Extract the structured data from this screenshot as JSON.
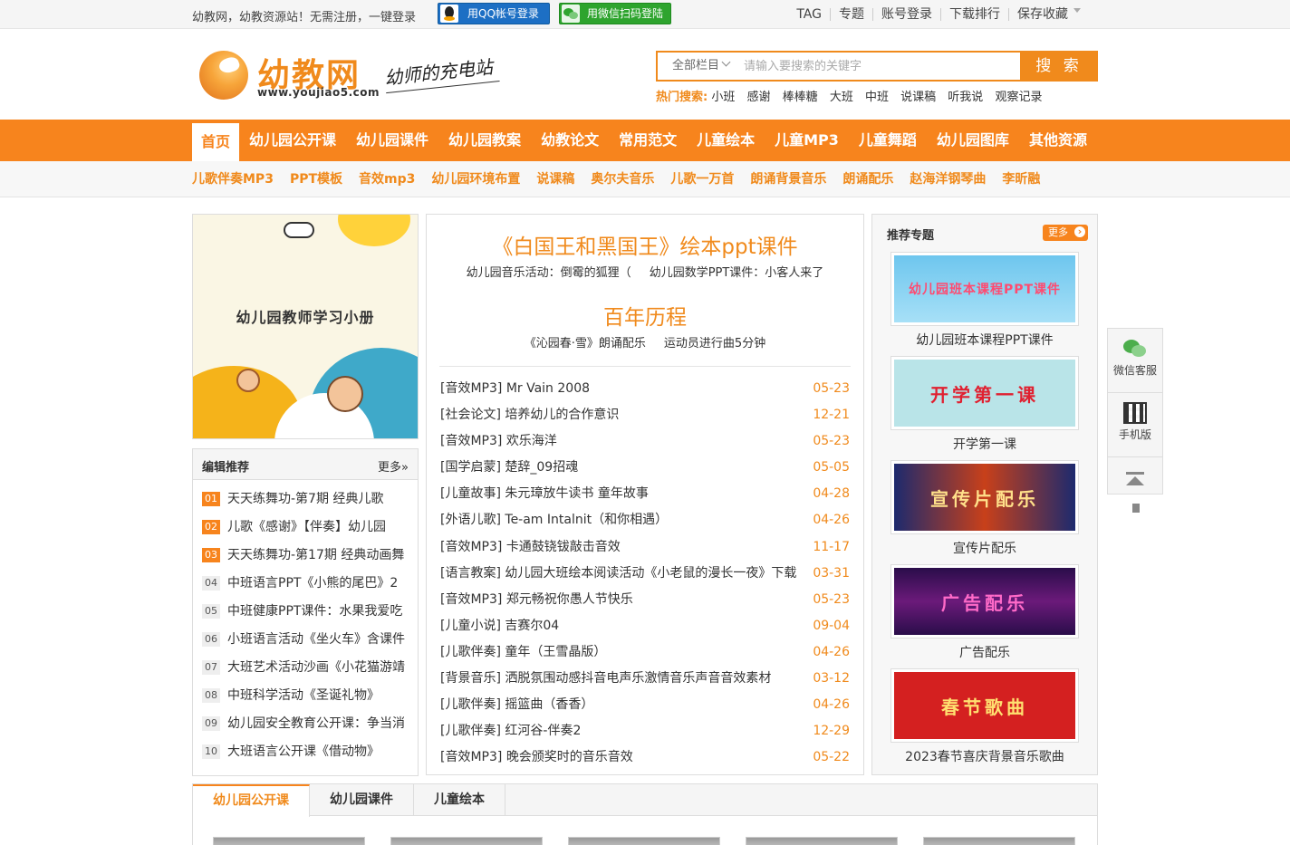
{
  "topbar": {
    "welcome": "幼教网，幼教资源站！无需注册，一键登录",
    "qq_login": "用QQ帐号登录",
    "wx_login": "用微信扫码登陆",
    "links": [
      "TAG",
      "专题",
      "账号登录",
      "下载排行",
      "保存收藏"
    ]
  },
  "header": {
    "logo_name": "幼教网",
    "logo_url": "www.youjiao5.com",
    "slogan": "幼师的充电站",
    "search_category": "全部栏目",
    "search_placeholder": "请输入要搜索的关键字",
    "search_button": "搜 索",
    "hot_label": "热门搜索:",
    "hot_words": [
      "小班",
      "感谢",
      "棒棒糖",
      "大班",
      "中班",
      "说课稿",
      "听我说",
      "观察记录"
    ]
  },
  "nav": [
    "首页",
    "幼儿园公开课",
    "幼儿园课件",
    "幼儿园教案",
    "幼教论文",
    "常用范文",
    "儿童绘本",
    "儿童MP3",
    "儿童舞蹈",
    "幼儿园图库",
    "其他资源"
  ],
  "subnav": [
    "儿歌伴奏MP3",
    "PPT模板",
    "音效mp3",
    "幼儿园环境布置",
    "说课稿",
    "奥尔夫音乐",
    "儿歌一万首",
    "朗诵背景音乐",
    "朗诵配乐",
    "赵海洋钢琴曲",
    "李昕融"
  ],
  "banner": {
    "title": "幼儿园教师学习小册"
  },
  "editor": {
    "title": "编辑推荐",
    "more": "更多»",
    "items": [
      {
        "n": "01",
        "t": "天天练舞功-第7期 经典儿歌"
      },
      {
        "n": "02",
        "t": "儿歌《感谢》【伴奏】幼儿园"
      },
      {
        "n": "03",
        "t": "天天练舞功-第17期 经典动画舞"
      },
      {
        "n": "04",
        "t": "中班语言PPT《小熊的尾巴》2"
      },
      {
        "n": "05",
        "t": "中班健康PPT课件：水果我爱吃"
      },
      {
        "n": "06",
        "t": "小班语言活动《坐火车》含课件"
      },
      {
        "n": "07",
        "t": "大班艺术活动沙画《小花猫游靖"
      },
      {
        "n": "08",
        "t": "中班科学活动《圣诞礼物》"
      },
      {
        "n": "09",
        "t": "幼儿园安全教育公开课：争当消"
      },
      {
        "n": "10",
        "t": "大班语言公开课《借动物》"
      }
    ]
  },
  "headline": {
    "h1": "《白国王和黑国王》绘本ppt课件",
    "sub1": [
      "幼儿园音乐活动：倒霉的狐狸（",
      "幼儿园数学PPT课件：小客人来了"
    ],
    "h2": "百年历程",
    "sub2": [
      "《沁园春·雪》朗诵配乐",
      "运动员进行曲5分钟"
    ]
  },
  "news": [
    {
      "tag": "[音效MP3]",
      "t": "Mr Vain 2008",
      "d": "05-23"
    },
    {
      "tag": "[社会论文]",
      "t": "培养幼儿的合作意识",
      "d": "12-21"
    },
    {
      "tag": "[音效MP3]",
      "t": "欢乐海洋",
      "d": "05-23"
    },
    {
      "tag": "[国学启蒙]",
      "t": "楚辞_09招魂",
      "d": "05-05"
    },
    {
      "tag": "[儿童故事]",
      "t": "朱元璋放牛读书 童年故事",
      "d": "04-28"
    },
    {
      "tag": "[外语儿歌]",
      "t": "Te-am Intalnit（和你相遇）",
      "d": "04-26"
    },
    {
      "tag": "[音效MP3]",
      "t": "卡通鼓铙钹敲击音效",
      "d": "11-17"
    },
    {
      "tag": "[语言教案]",
      "t": "幼儿园大班绘本阅读活动《小老鼠的漫长一夜》下载",
      "d": "03-31"
    },
    {
      "tag": "[音效MP3]",
      "t": "郑元畅祝你愚人节快乐",
      "d": "05-23"
    },
    {
      "tag": "[儿童小说]",
      "t": "吉赛尔04",
      "d": "09-04"
    },
    {
      "tag": "[儿歌伴奏]",
      "t": "童年（王雪晶版）",
      "d": "04-26"
    },
    {
      "tag": "[背景音乐]",
      "t": "洒脱氛围动感抖音电声乐激情音乐声音音效素材",
      "d": "03-12"
    },
    {
      "tag": "[儿歌伴奏]",
      "t": "摇篮曲（香香）",
      "d": "04-26"
    },
    {
      "tag": "[儿歌伴奏]",
      "t": "红河谷-伴奏2",
      "d": "12-29"
    },
    {
      "tag": "[音效MP3]",
      "t": "晚会颁奖时的音乐音效",
      "d": "05-22"
    }
  ],
  "topics": {
    "title": "推荐专题",
    "more": "更多",
    "items": [
      {
        "img_text": "幼儿园班本课程PPT课件",
        "cap": "幼儿园班本课程PPT课件"
      },
      {
        "img_text": "开学第一课",
        "cap": "开学第一课"
      },
      {
        "img_text": "宣传片配乐",
        "cap": "宣传片配乐"
      },
      {
        "img_text": "广告配乐",
        "cap": "广告配乐"
      },
      {
        "img_text": "春节歌曲",
        "cap": "2023春节喜庆背景音乐歌曲"
      }
    ]
  },
  "float": {
    "wx": "微信客服",
    "mobile": "手机版"
  },
  "tabs": [
    "幼儿园公开课",
    "幼儿园课件",
    "儿童绘本"
  ]
}
